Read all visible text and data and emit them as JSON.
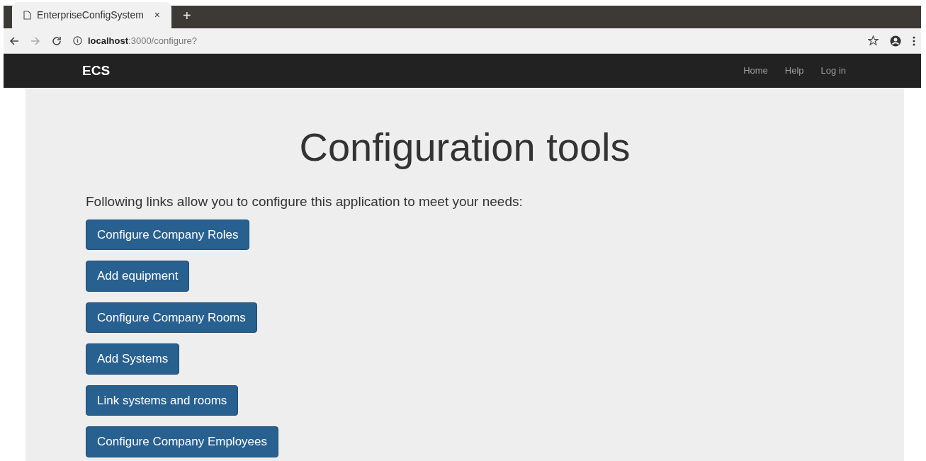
{
  "browser": {
    "tab": {
      "title": "EnterpriseConfigSystem",
      "close": "×"
    },
    "new_tab": "+",
    "url": "**localhost**:3000/configure?"
  },
  "navbar": {
    "brand": "ECS",
    "links": [
      {
        "label": "Home"
      },
      {
        "label": "Help"
      },
      {
        "label": "Log in"
      }
    ]
  },
  "jumbotron": {
    "heading": "Configuration tools",
    "intro": "Following links allow you to configure this application to meet your needs:",
    "buttons": [
      {
        "label": "Configure Company Roles"
      },
      {
        "label": "Add equipment"
      },
      {
        "label": "Configure Company Rooms"
      },
      {
        "label": "Add Systems"
      },
      {
        "label": "Link systems and rooms"
      },
      {
        "label": "Configure Company Employees"
      }
    ]
  }
}
